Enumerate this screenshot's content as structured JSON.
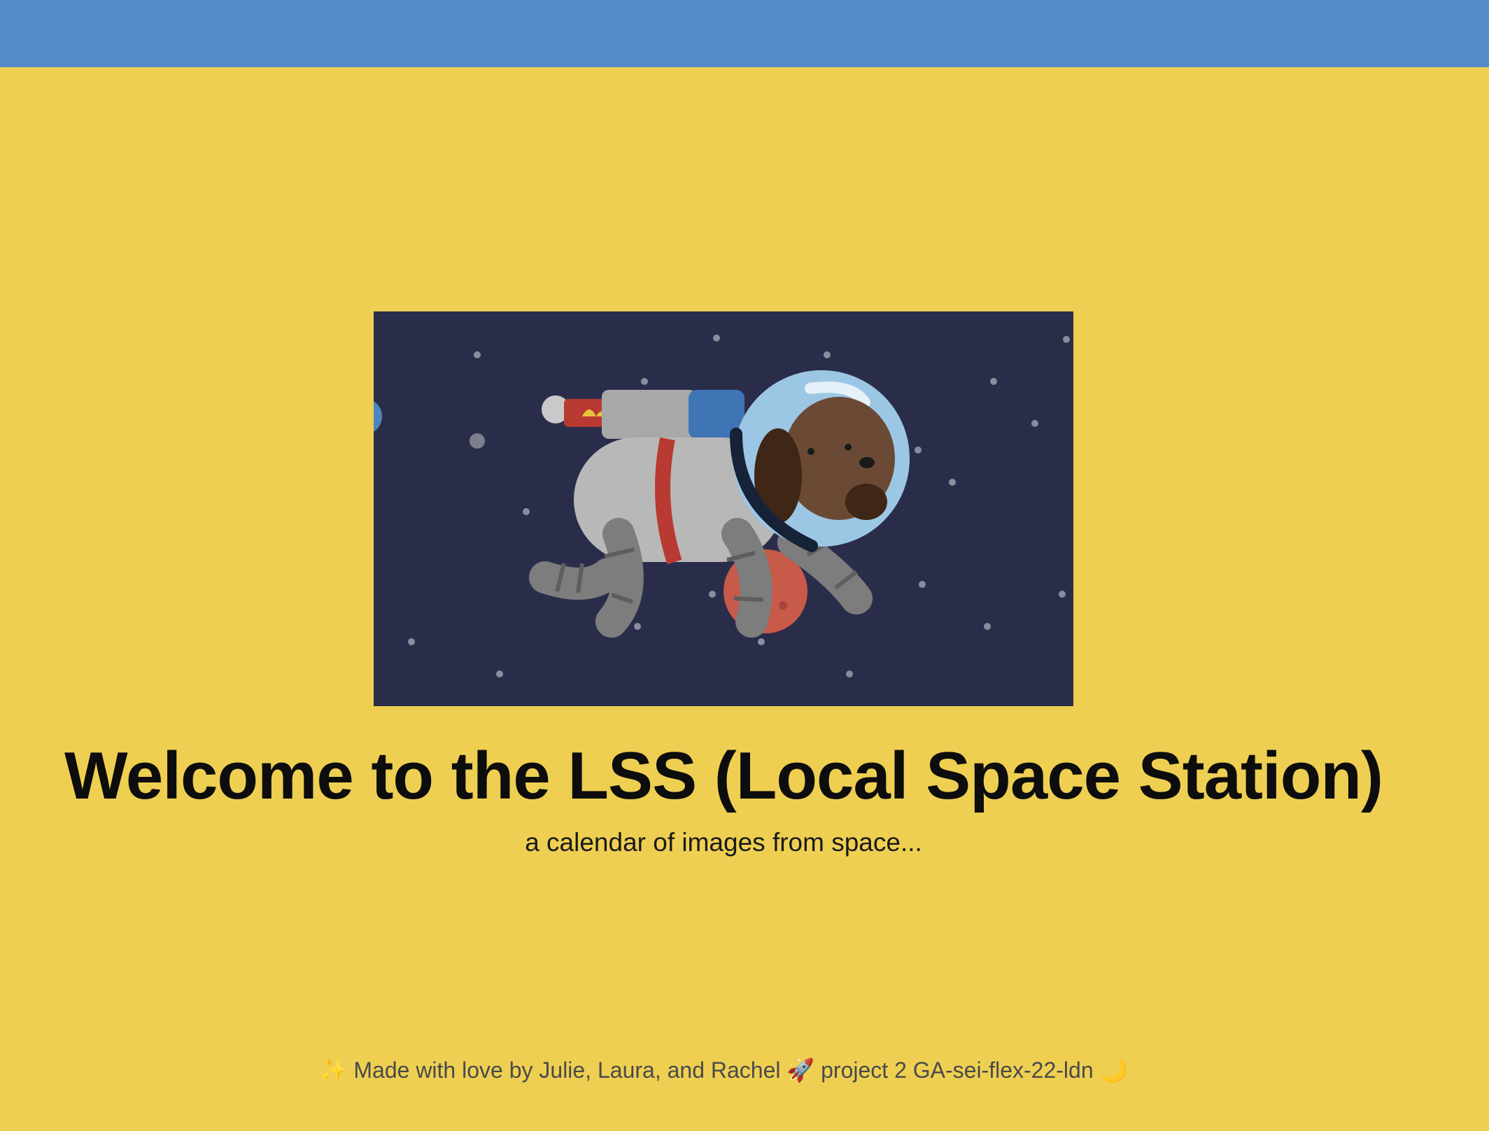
{
  "navbar": {
    "color": "#548ccb"
  },
  "hero": {
    "image": {
      "description_icon": "astronaut-dog-illustration"
    },
    "title": "Welcome to the LSS (Local Space Station)",
    "subtitle": "a calendar of images from space..."
  },
  "footer": {
    "sparkle_icon": "✨",
    "text_before": "Made with love by Julie, Laura, and Rachel",
    "rocket_icon": "🚀",
    "text_after": "project 2 GA-sei-flex-22-ldn",
    "moon_icon": "🌙"
  },
  "colors": {
    "background": "#eecf52",
    "navbar": "#548ccb",
    "image_bg": "#2a2d4a",
    "text": "#0d0d0d"
  }
}
